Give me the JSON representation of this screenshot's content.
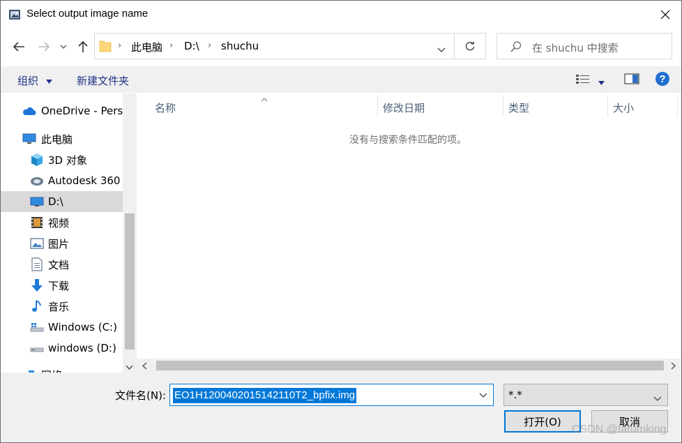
{
  "window": {
    "title": "Select output image name",
    "close_icon": "close-icon"
  },
  "address": {
    "crumbs": [
      "此电脑",
      "D:\\",
      "shuchu"
    ],
    "search_placeholder": "在 shuchu 中搜索"
  },
  "toolbar": {
    "organize_label": "组织",
    "new_folder_label": "新建文件夹",
    "help_label": "?"
  },
  "nav": {
    "items": [
      {
        "label": "OneDrive - Pers",
        "icon": "onedrive-cloud-icon"
      },
      {
        "label": "此电脑",
        "icon": "computer-icon"
      },
      {
        "label": "3D 对象",
        "icon": "3d-objects-icon"
      },
      {
        "label": "Autodesk 360",
        "icon": "autodesk-icon"
      },
      {
        "label": "D:\\",
        "icon": "drive-icon",
        "selected": true
      },
      {
        "label": "视频",
        "icon": "video-icon"
      },
      {
        "label": "图片",
        "icon": "pictures-icon"
      },
      {
        "label": "文档",
        "icon": "documents-icon"
      },
      {
        "label": "下载",
        "icon": "download-icon"
      },
      {
        "label": "音乐",
        "icon": "music-icon"
      },
      {
        "label": "Windows (C:)",
        "icon": "windows-drive-icon"
      },
      {
        "label": "windows (D:)",
        "icon": "disk-drive-icon"
      },
      {
        "label": "网络",
        "icon": "network-icon"
      }
    ]
  },
  "list": {
    "columns": [
      "名称",
      "修改日期",
      "类型",
      "大小"
    ],
    "empty_message": "没有与搜索条件匹配的项。"
  },
  "bottom": {
    "filename_label": "文件名(N):",
    "filename_value": "EO1H1200402015142110T2_bpfix.img",
    "filetype_value": "*.*",
    "open_label": "打开(O)",
    "cancel_label": "取消"
  },
  "watermark": "CSDN @tatumking",
  "colors": {
    "accent": "#0078d7",
    "toolbar_text": "#1e3287",
    "selection": "#d9d9d9",
    "panel": "#f0f0f0"
  }
}
